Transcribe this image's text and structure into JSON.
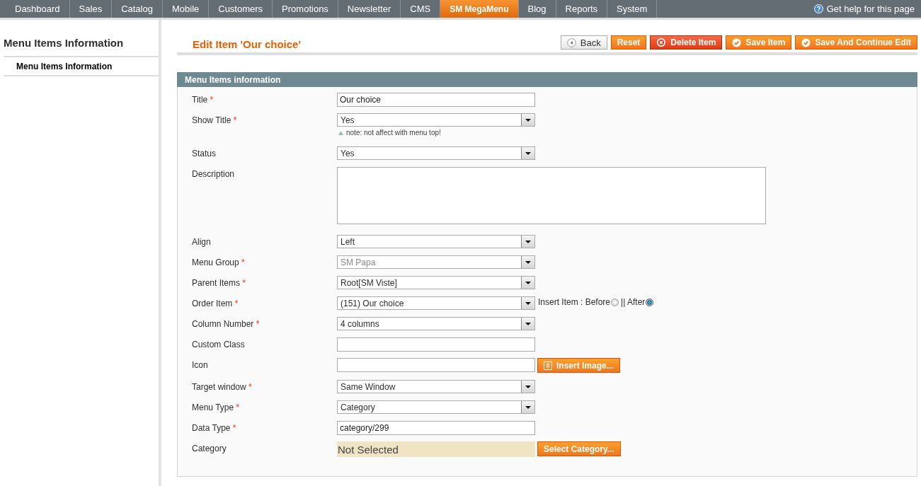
{
  "nav": {
    "tabs": [
      {
        "label": "Dashboard",
        "selected": false
      },
      {
        "label": "Sales",
        "selected": false
      },
      {
        "label": "Catalog",
        "selected": false
      },
      {
        "label": "Mobile",
        "selected": false
      },
      {
        "label": "Customers",
        "selected": false
      },
      {
        "label": "Promotions",
        "selected": false
      },
      {
        "label": "Newsletter",
        "selected": false
      },
      {
        "label": "CMS",
        "selected": false
      },
      {
        "label": "SM MegaMenu",
        "selected": true
      },
      {
        "label": "Blog",
        "selected": false
      },
      {
        "label": "Reports",
        "selected": false
      },
      {
        "label": "System",
        "selected": false
      }
    ],
    "help": "Get help for this page"
  },
  "sidebar": {
    "title": "Menu Items Information",
    "items": [
      {
        "label": "Menu Items Information",
        "selected": true
      }
    ]
  },
  "page_title": "Edit Item 'Our choice'",
  "buttons": [
    {
      "label": "Back",
      "kind": "back"
    },
    {
      "label": "Reset",
      "kind": "plain"
    },
    {
      "label": "Delete Item",
      "kind": "delete"
    },
    {
      "label": "Save Item",
      "kind": "save"
    },
    {
      "label": "Save And Continue Edit",
      "kind": "save"
    }
  ],
  "section_title": "Menu Items information",
  "fields": [
    {
      "label": "Title",
      "required_mark": "*",
      "kind": "text",
      "value": "Our choice"
    },
    {
      "label": "Show Title",
      "required_mark": "*",
      "kind": "select",
      "value": "Yes",
      "note": "note: not affect with menu top!"
    },
    {
      "label": "Status",
      "kind": "select",
      "value": "Yes"
    },
    {
      "label": "Description",
      "kind": "textarea"
    },
    {
      "label": "Align",
      "kind": "select",
      "value": "Left"
    },
    {
      "label": "Menu Group",
      "required_mark": "*",
      "kind": "select",
      "value": "SM Papa",
      "disabled": true
    },
    {
      "label": "Parent Items",
      "required_mark": "*",
      "kind": "select",
      "value": "Root[SM Viste]"
    },
    {
      "label": "Order Item",
      "required_mark": "*",
      "kind": "select",
      "value": "(151) Our choice",
      "radios": [
        {
          "label": "Insert Item : Before",
          "selected": false
        },
        {
          "label": "|| After",
          "selected": true
        }
      ]
    },
    {
      "label": "Column Number",
      "required_mark": "*",
      "kind": "select",
      "value": "4 columns"
    },
    {
      "label": "Custom Class",
      "kind": "text"
    },
    {
      "label": "Icon",
      "kind": "text",
      "button": "Insert Image..."
    },
    {
      "label": "Target window",
      "required_mark": "*",
      "kind": "select",
      "value": "Same Window"
    },
    {
      "label": "Menu Type",
      "required_mark": "*",
      "kind": "select",
      "value": "Category"
    },
    {
      "label": "Data Type",
      "required_mark": "*",
      "kind": "text",
      "value": "category/299"
    },
    {
      "label": "Category",
      "kind": "chooser",
      "value": "Not Selected",
      "button": "Select Category..."
    }
  ]
}
